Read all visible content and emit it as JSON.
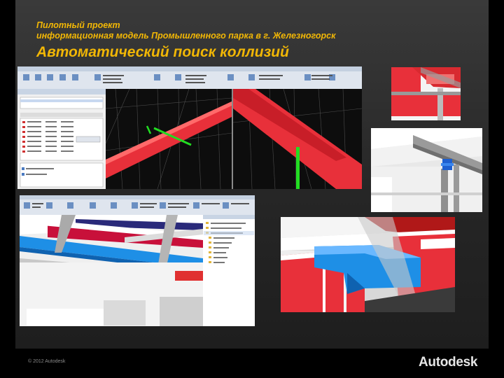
{
  "header": {
    "line1": "Пилотный проект",
    "line2": "информационная модель Промышленного парка в г. Железногорск",
    "title": "Автоматический поиск коллизий"
  },
  "footer": {
    "copyright": "© 2012 Autodesk",
    "logo": "Autodesk"
  },
  "colors": {
    "accent": "#f2b705",
    "clash_red": "#e8303a",
    "clash_green": "#22dd22",
    "duct_blue": "#1e8fe6"
  },
  "screenshots": [
    "navisworks-clash-detective-top",
    "clash-detail-right-top",
    "clash-detail-right-middle",
    "navisworks-clash-detective-bottom",
    "clash-detail-right-bottom"
  ]
}
